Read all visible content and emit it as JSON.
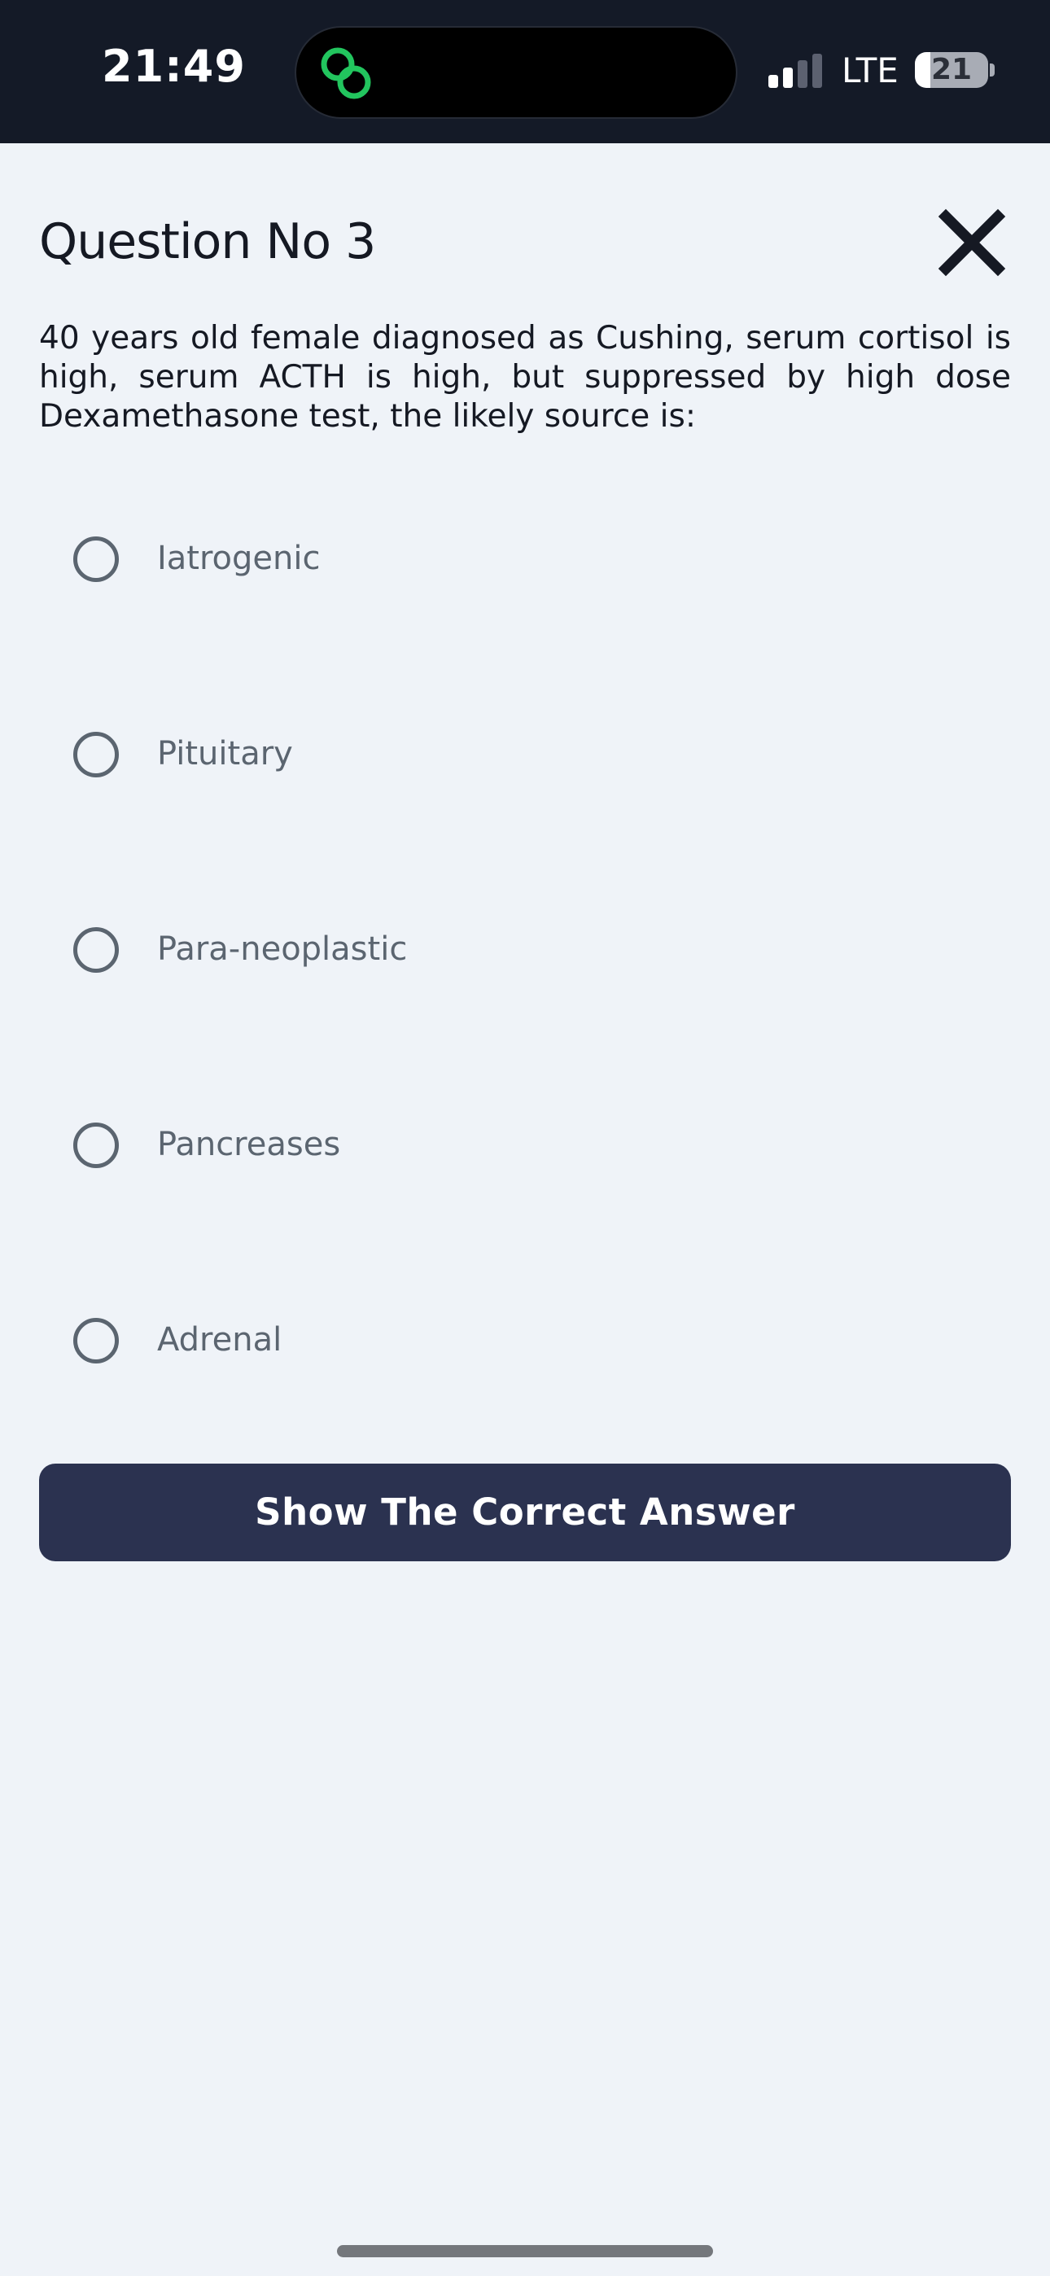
{
  "status_bar": {
    "time": "21:49",
    "network": "LTE",
    "battery_level": "21",
    "battery_fraction": 0.21,
    "island_icon": "link-chain-icon",
    "colors": {
      "background": "#141a27",
      "island_icon": "#22c55e"
    }
  },
  "quiz": {
    "title": "Question No 3",
    "close_icon": "close-icon",
    "question": "40 years old female diagnosed as Cushing, serum cortisol is high, serum ACTH is high, but suppressed by high dose Dexamethasone test, the likely source is:",
    "options": [
      {
        "label": "Iatrogenic",
        "selected": false
      },
      {
        "label": "Pituitary",
        "selected": false
      },
      {
        "label": "Para-neoplastic",
        "selected": false
      },
      {
        "label": "Pancreases",
        "selected": false
      },
      {
        "label": "Adrenal",
        "selected": false
      }
    ],
    "show_answer_label": "Show The Correct Answer"
  },
  "colors": {
    "background": "#eff3f8",
    "primary_button": "#2b3250",
    "option_text": "#5b6570",
    "heading_text": "#151923"
  }
}
